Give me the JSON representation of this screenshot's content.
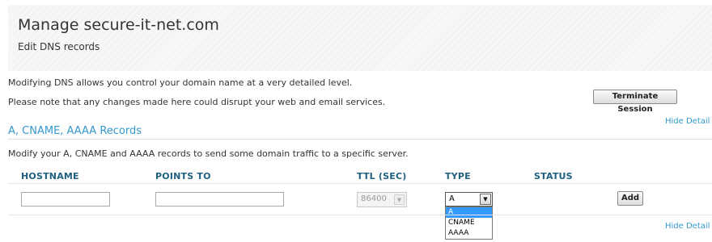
{
  "header": {
    "title": "Manage secure-it-net.com",
    "subtitle": "Edit DNS records"
  },
  "intro": {
    "line1": "Modifying DNS allows you control your domain name at a very detailed level.",
    "line2": "Please note that any changes made here could disrupt your web and email services."
  },
  "buttons": {
    "terminate": "Terminate Session",
    "add": "Add"
  },
  "links": {
    "hide_detail": "Hide Detail"
  },
  "section": {
    "title": "A, CNAME, AAAA Records",
    "description": "Modify your A, CNAME and AAAA records to send some domain traffic to a specific server."
  },
  "table": {
    "columns": [
      "HOSTNAME",
      "POINTS TO",
      "TTL (SEC)",
      "TYPE",
      "STATUS"
    ],
    "row": {
      "hostname": "",
      "points_to": "",
      "ttl": "86400",
      "type": "A"
    }
  },
  "type_options": [
    "A",
    "CNAME",
    "AAAA"
  ],
  "colors": {
    "accent": "#3399cc",
    "header_text": "#1f5f80",
    "selection": "#3399ff"
  }
}
